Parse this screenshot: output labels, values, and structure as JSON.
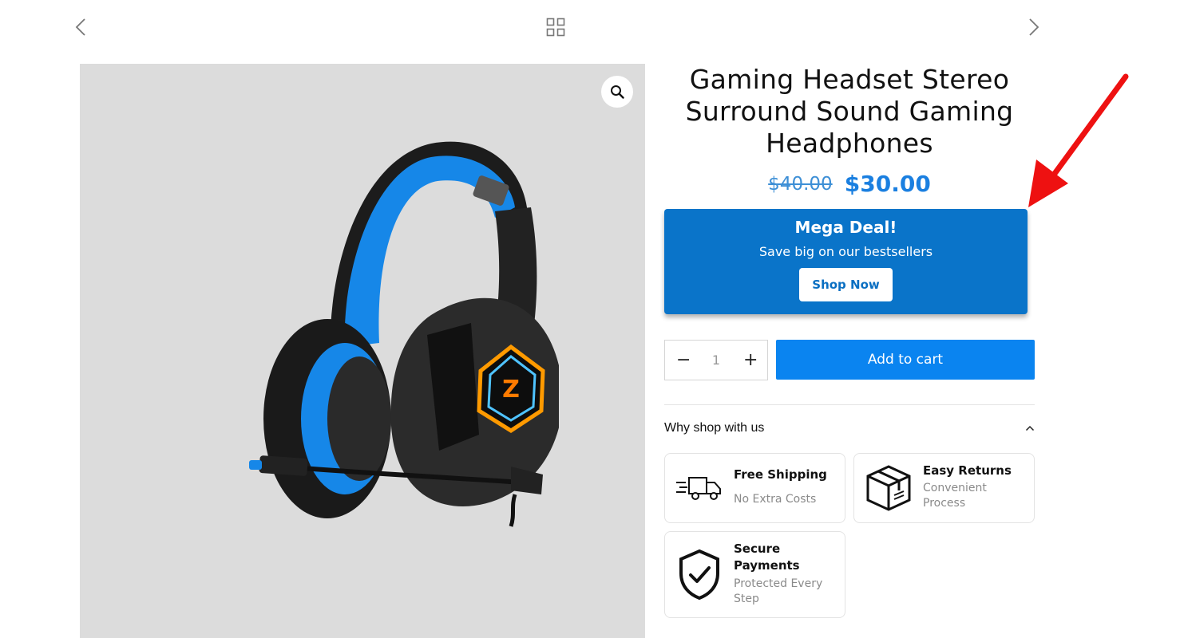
{
  "nav": {
    "prev_icon": "chevron-left-icon",
    "grid_icon": "grid-icon",
    "next_icon": "chevron-right-icon"
  },
  "gallery": {
    "zoom_icon": "search-icon",
    "image": "gaming-headset-photo"
  },
  "product": {
    "title": "Gaming Headset Stereo Surround Sound Gaming Headphones",
    "old_price": "$40.00",
    "price": "$30.00"
  },
  "deal": {
    "title": "Mega Deal!",
    "subtitle": "Save big on our bestsellers",
    "button": "Shop Now"
  },
  "cart": {
    "minus": "−",
    "quantity": "1",
    "plus": "+",
    "add_button": "Add to cart"
  },
  "why": {
    "label": "Why shop with us",
    "items": [
      {
        "title": "Free Shipping",
        "subtitle": "No Extra Costs",
        "icon": "truck-icon"
      },
      {
        "title": "Easy Returns",
        "subtitle": "Convenient Process",
        "icon": "box-icon"
      },
      {
        "title": "Secure Payments",
        "subtitle": "Protected Every Step",
        "icon": "shield-check-icon"
      }
    ]
  },
  "colors": {
    "accent": "#0a84f0",
    "deal_bg": "#0a74c9",
    "price": "#1a7fe0",
    "annotation_arrow": "#ee1111"
  }
}
